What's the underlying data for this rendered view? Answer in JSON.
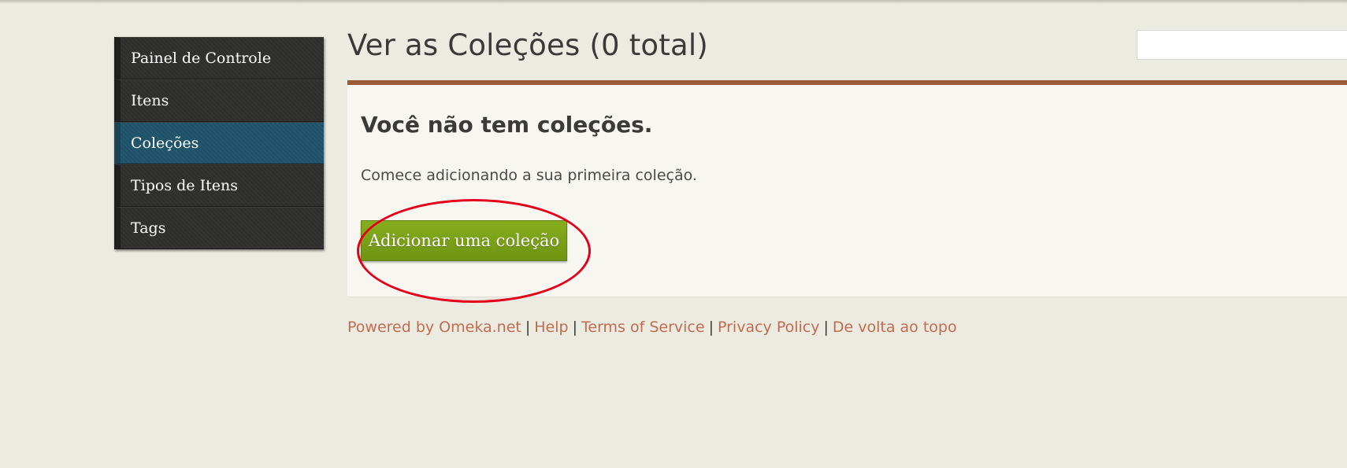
{
  "sidebar": {
    "items": [
      {
        "label": "Painel de Controle"
      },
      {
        "label": "Itens"
      },
      {
        "label": "Coleções"
      },
      {
        "label": "Tipos de Itens"
      },
      {
        "label": "Tags"
      }
    ],
    "active_item": "Coleções"
  },
  "header": {
    "title": "Ver as Coleções (0 total)",
    "search_value": ""
  },
  "main": {
    "heading": "Você não tem coleções.",
    "text": "Comece adicionando a sua primeira coleção.",
    "add_button_label": "Adicionar uma coleção"
  },
  "footer": {
    "links": [
      "Powered by Omeka.net",
      "Help",
      "Terms of Service",
      "Privacy Policy",
      "De volta ao topo"
    ],
    "separator": "|"
  },
  "colors": {
    "accent_rule": "#9a5b36",
    "sidebar_active": "#24586f",
    "button_green": "#7ba31a",
    "link": "#c26c4f",
    "annotation_red": "#e4001b"
  }
}
